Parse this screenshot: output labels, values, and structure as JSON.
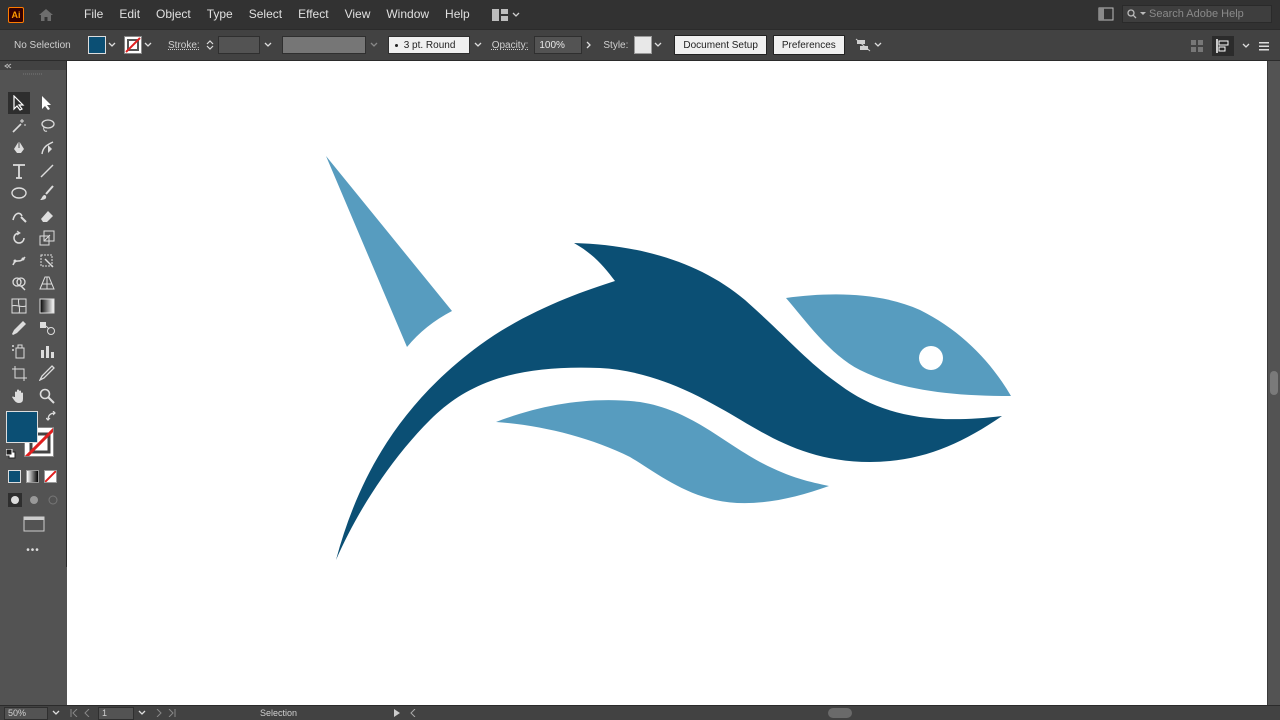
{
  "app": {
    "logo_text": "Ai"
  },
  "menu": {
    "items": [
      "File",
      "Edit",
      "Object",
      "Type",
      "Select",
      "Effect",
      "View",
      "Window",
      "Help"
    ]
  },
  "search": {
    "placeholder": "Search Adobe Help"
  },
  "control_bar": {
    "selection_label": "No Selection",
    "fill_color": "#0b4f74",
    "stroke_label": "Stroke:",
    "brush_label": "3 pt. Round",
    "opacity_label": "Opacity:",
    "opacity_value": "100%",
    "style_label": "Style:",
    "document_setup_label": "Document Setup",
    "preferences_label": "Preferences"
  },
  "tools": {
    "rows": [
      [
        "selection-tool-icon",
        "direct-selection-tool-icon"
      ],
      [
        "magic-wand-tool-icon",
        "lasso-tool-icon"
      ],
      [
        "pen-tool-icon",
        "curvature-tool-icon"
      ],
      [
        "type-tool-icon",
        "line-segment-tool-icon"
      ],
      [
        "ellipse-tool-icon",
        "paintbrush-tool-icon"
      ],
      [
        "shaper-tool-icon",
        "eraser-tool-icon"
      ],
      [
        "rotate-tool-icon",
        "scale-tool-icon"
      ],
      [
        "puppet-warp-tool-icon",
        "free-transform-tool-icon"
      ],
      [
        "shape-builder-tool-icon",
        "perspective-grid-tool-icon"
      ],
      [
        "mesh-tool-icon",
        "gradient-tool-icon"
      ],
      [
        "eyedropper-tool-icon",
        "blend-tool-icon"
      ],
      [
        "symbol-sprayer-tool-icon",
        "column-graph-tool-icon"
      ],
      [
        "artboard-tool-icon",
        "slice-tool-icon"
      ],
      [
        "hand-tool-icon",
        "zoom-tool-icon"
      ]
    ],
    "fill_color": "#0b4f74",
    "more_label": "•••"
  },
  "artwork": {
    "dark_color": "#0b4f74",
    "light_color": "#579cbf"
  },
  "status_bar": {
    "zoom": "50%",
    "artboard_number": "1",
    "tool_name": "Selection"
  }
}
